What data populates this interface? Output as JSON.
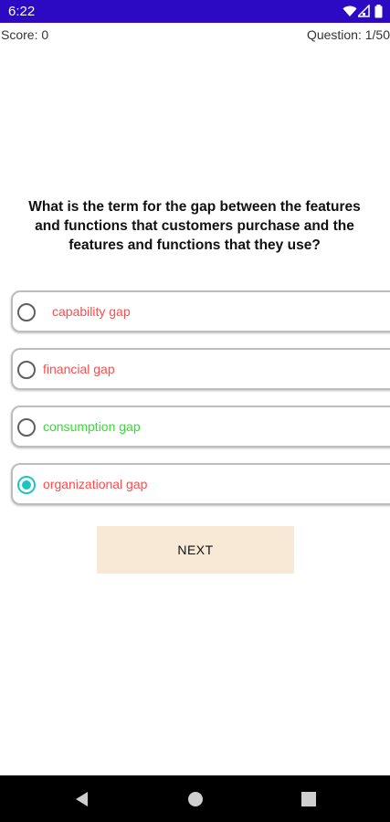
{
  "status_bar": {
    "time": "6:22",
    "background_color": "#2c0ac4",
    "icons": [
      "wifi-icon",
      "signal-icon",
      "battery-icon"
    ]
  },
  "info": {
    "score": "Score: 0",
    "question_count": "Question: 1/50"
  },
  "question": {
    "text": "What is the term for the gap between the features and functions that customers purchase and the features and functions that they use?"
  },
  "options": [
    {
      "label": "capability gap",
      "color": "#ff4b4b",
      "selected": false
    },
    {
      "label": "financial gap",
      "color": "#ff4b4b",
      "selected": false
    },
    {
      "label": "consumption gap",
      "color": "#2fe02f",
      "selected": false
    },
    {
      "label": "organizational gap",
      "color": "#ff4b4b",
      "selected": true
    }
  ],
  "next_button": {
    "label": "NEXT",
    "background_color": "#f8e8d6"
  },
  "nav_bar": {
    "icons": [
      "back-icon",
      "home-icon",
      "recents-icon"
    ]
  }
}
